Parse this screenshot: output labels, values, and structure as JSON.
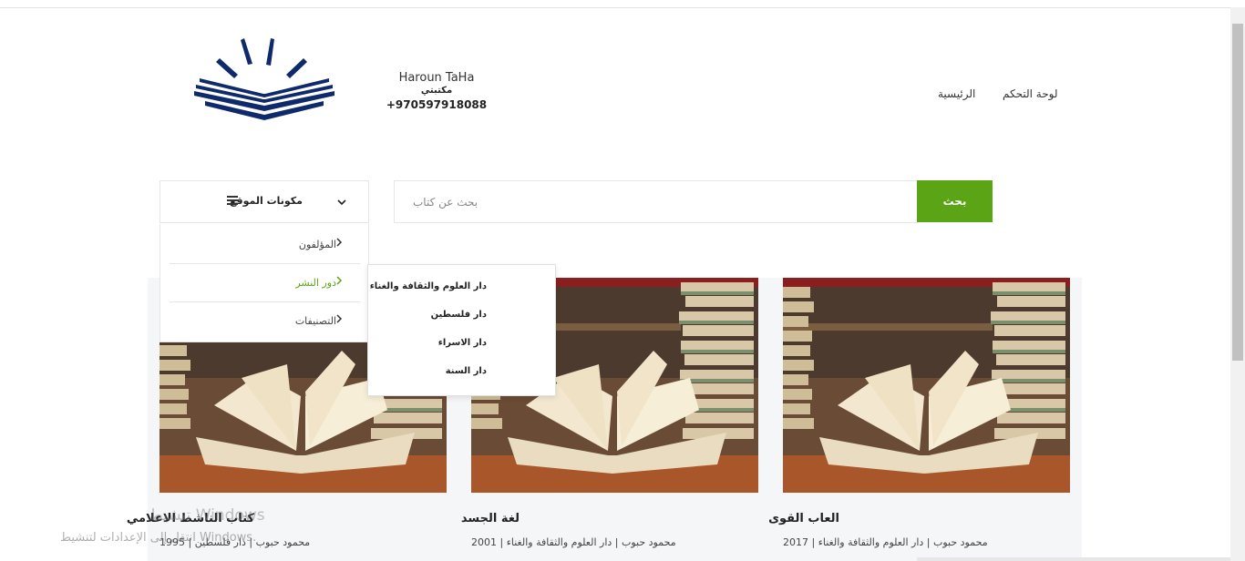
{
  "header": {
    "user_name": "Haroun TaHa",
    "library_label": "مكتبتي",
    "phone": "+970597918088",
    "nav": [
      {
        "label": "لوحة التحكم"
      },
      {
        "label": "الرئيسية"
      }
    ]
  },
  "categories": {
    "title": "مكونات الموقع",
    "items": [
      {
        "label": "المؤلفون"
      },
      {
        "label": "دور النشر",
        "active": true
      },
      {
        "label": "التصنيفات"
      }
    ]
  },
  "publishers_submenu": {
    "items": [
      {
        "label": "دار العلوم والثقافة والغناء"
      },
      {
        "label": "دار فلسطين"
      },
      {
        "label": "دار الاسراء"
      },
      {
        "label": "دار السنة"
      }
    ]
  },
  "search": {
    "placeholder": "بحث عن كتاب",
    "button_label": "بحث"
  },
  "books": [
    {
      "title": "العاب القوى",
      "publisher": "دار العلوم والثقافة والغناء",
      "author": "محمود حبوب",
      "year": "2017"
    },
    {
      "title": "لغة الجسد",
      "publisher": "دار العلوم والثقافة والغناء",
      "author": "محمود حبوب",
      "year": "2001"
    },
    {
      "title": "كتاب الناشط الاعلامي",
      "publisher": "دار فلسطين",
      "author": "محمود حبوب",
      "year": "1995"
    }
  ],
  "windows_watermark": {
    "line1": "تنشيط Windows",
    "line2": "انتقل إلى الإعدادات لتنشيط Windows."
  },
  "colors": {
    "accent": "#5aa415",
    "logo_blue": "#0f2a6b"
  },
  "icons": [
    "book-logo-icon",
    "chevron-down-icon",
    "menu-icon",
    "chevron-right-icon"
  ]
}
